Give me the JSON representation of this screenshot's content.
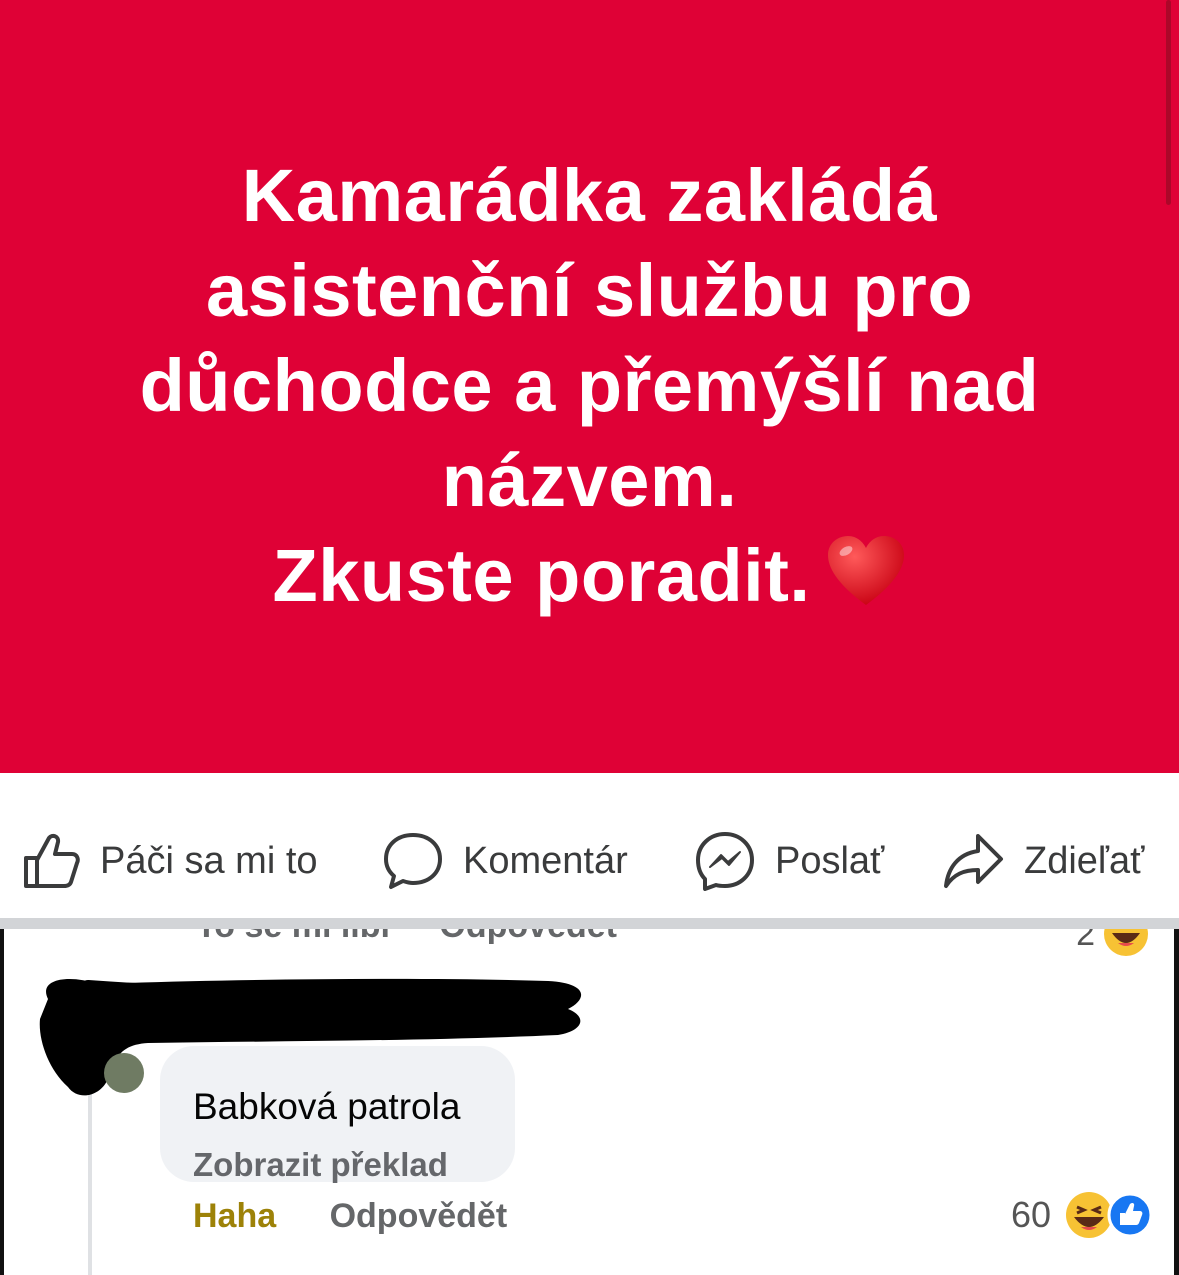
{
  "post": {
    "background": "#df0136",
    "lines": [
      "Kamarádka zakládá",
      "asistenční službu pro",
      "důchodce a přemýšlí nad",
      "názvem.",
      "Zkuste poradit."
    ],
    "emoji": "heart-icon"
  },
  "actions": {
    "like": "Páči sa mi to",
    "comment": "Komentár",
    "send": "Poslať",
    "share": "Zdieľať"
  },
  "previous_comment": {
    "like_label": "To se mi líbí",
    "reply_label": "Odpovědět",
    "reaction_count": "2"
  },
  "comment": {
    "text": "Babková patrola",
    "translate": "Zobrazit překlad",
    "reaction_label": "Haha",
    "reply_label": "Odpovědět",
    "reaction_count": "60",
    "reaction_icons": [
      "haha-icon",
      "like-icon"
    ]
  }
}
